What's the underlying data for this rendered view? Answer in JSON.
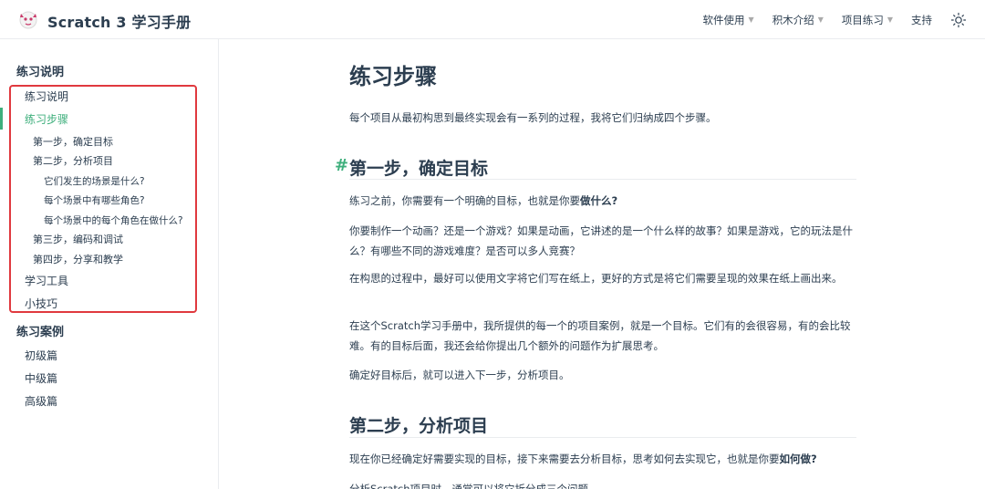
{
  "header": {
    "title": "Scratch 3 学习手册",
    "nav": [
      {
        "label": "软件使用",
        "dropdown": true
      },
      {
        "label": "积木介绍",
        "dropdown": true
      },
      {
        "label": "项目练习",
        "dropdown": true
      },
      {
        "label": "支持",
        "dropdown": false
      }
    ],
    "theme_icon": "sun-icon"
  },
  "sidebar": {
    "group1": "练习说明",
    "items": [
      {
        "label": "练习说明",
        "level": 1,
        "active": false
      },
      {
        "label": "练习步骤",
        "level": 1,
        "active": true
      },
      {
        "label": "第一步，确定目标",
        "level": 2
      },
      {
        "label": "第二步，分析项目",
        "level": 2
      },
      {
        "label": "它们发生的场景是什么?",
        "level": 3
      },
      {
        "label": "每个场景中有哪些角色?",
        "level": 3
      },
      {
        "label": "每个场景中的每个角色在做什么?",
        "level": 3
      },
      {
        "label": "第三步，编码和调试",
        "level": 2
      },
      {
        "label": "第四步，分享和教学",
        "level": 2
      },
      {
        "label": "学习工具",
        "level": 1
      },
      {
        "label": "小技巧",
        "level": 1
      }
    ],
    "group2": "练习案例",
    "items2": [
      {
        "label": "初级篇"
      },
      {
        "label": "中级篇"
      },
      {
        "label": "高级篇"
      }
    ]
  },
  "main": {
    "title": "练习步骤",
    "intro": "每个项目从最初构思到最终实现会有一系列的过程，我将它们归纳成四个步骤。",
    "section1": {
      "anchor": "#",
      "heading": "第一步，确定目标",
      "p1_text": "练习之前，你需要有一个明确的目标，也就是你要",
      "p1_bold": "做什么?",
      "p2": "你要制作一个动画？还是一个游戏？如果是动画，它讲述的是一个什么样的故事？如果是游戏，它的玩法是什么？有哪些不同的游戏难度？是否可以多人竞赛？",
      "p3": "在构思的过程中，最好可以使用文字将它们写在纸上，更好的方式是将它们需要呈现的效果在纸上画出来。",
      "p4": "在这个Scratch学习手册中，我所提供的每一个的项目案例，就是一个目标。它们有的会很容易，有的会比较难。有的目标后面，我还会给你提出几个额外的问题作为扩展思考。",
      "p5": "确定好目标后，就可以进入下一步，分析项目。"
    },
    "section2": {
      "heading": "第二步，分析项目",
      "p1_text": "现在你已经确定好需要实现的目标，接下来需要去分析目标，思考如何去实现它，也就是你要",
      "p1_bold": "如何做?",
      "p2_partial": "分析Scratch项目时，通常可以将它拆分成三个问题"
    }
  }
}
